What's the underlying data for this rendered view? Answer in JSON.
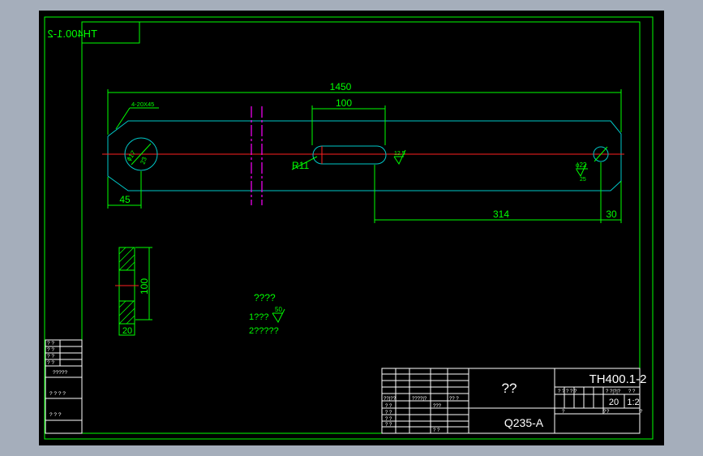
{
  "drawing": {
    "mirrored_code": "TH400.1-2",
    "code": "TH400.1-2",
    "name": "??",
    "material": "Q235-A",
    "scale": "1:2",
    "quantity": "20"
  },
  "dimensions": {
    "overall_length": "1450",
    "slot_length": "100",
    "left_offset": "45",
    "hole_spacing": "314",
    "right_offset": "30",
    "slot_radius": "R11",
    "chamfer": "4-20X45",
    "left_hole": "ϕ17",
    "left_hole_depth": "23",
    "right_hole": "ϕ22",
    "right_hole_depth": "25",
    "roughness_main": "12.5",
    "section_height": "100",
    "section_width": "20"
  },
  "notes": {
    "heading": "????",
    "line1": "1???",
    "line1_roughness": "50",
    "line2": "2?????"
  },
  "side_table": {
    "rows": [
      "? ?",
      "? ?",
      "? ?",
      "? ?",
      "?????"
    ],
    "sign1": "? ? ? ?",
    "sign2": "? ? ?"
  },
  "title_block": {
    "h1": "??|??",
    "h2": "????|?",
    "h3": "?? ?",
    "r1": "? ?",
    "r2": "???",
    "r3": "? ?",
    "r4": "? ?",
    "r5": "? ?",
    "r6": "? ?",
    "stage_labels": "? ? ? ? ?",
    "stage_labels2": "? ?",
    "stage_label3": "? ?|?|?",
    "weight_label": "?",
    "bottom_small1": "?",
    "bottom_small2": "?",
    "bottom_small3": "?"
  }
}
